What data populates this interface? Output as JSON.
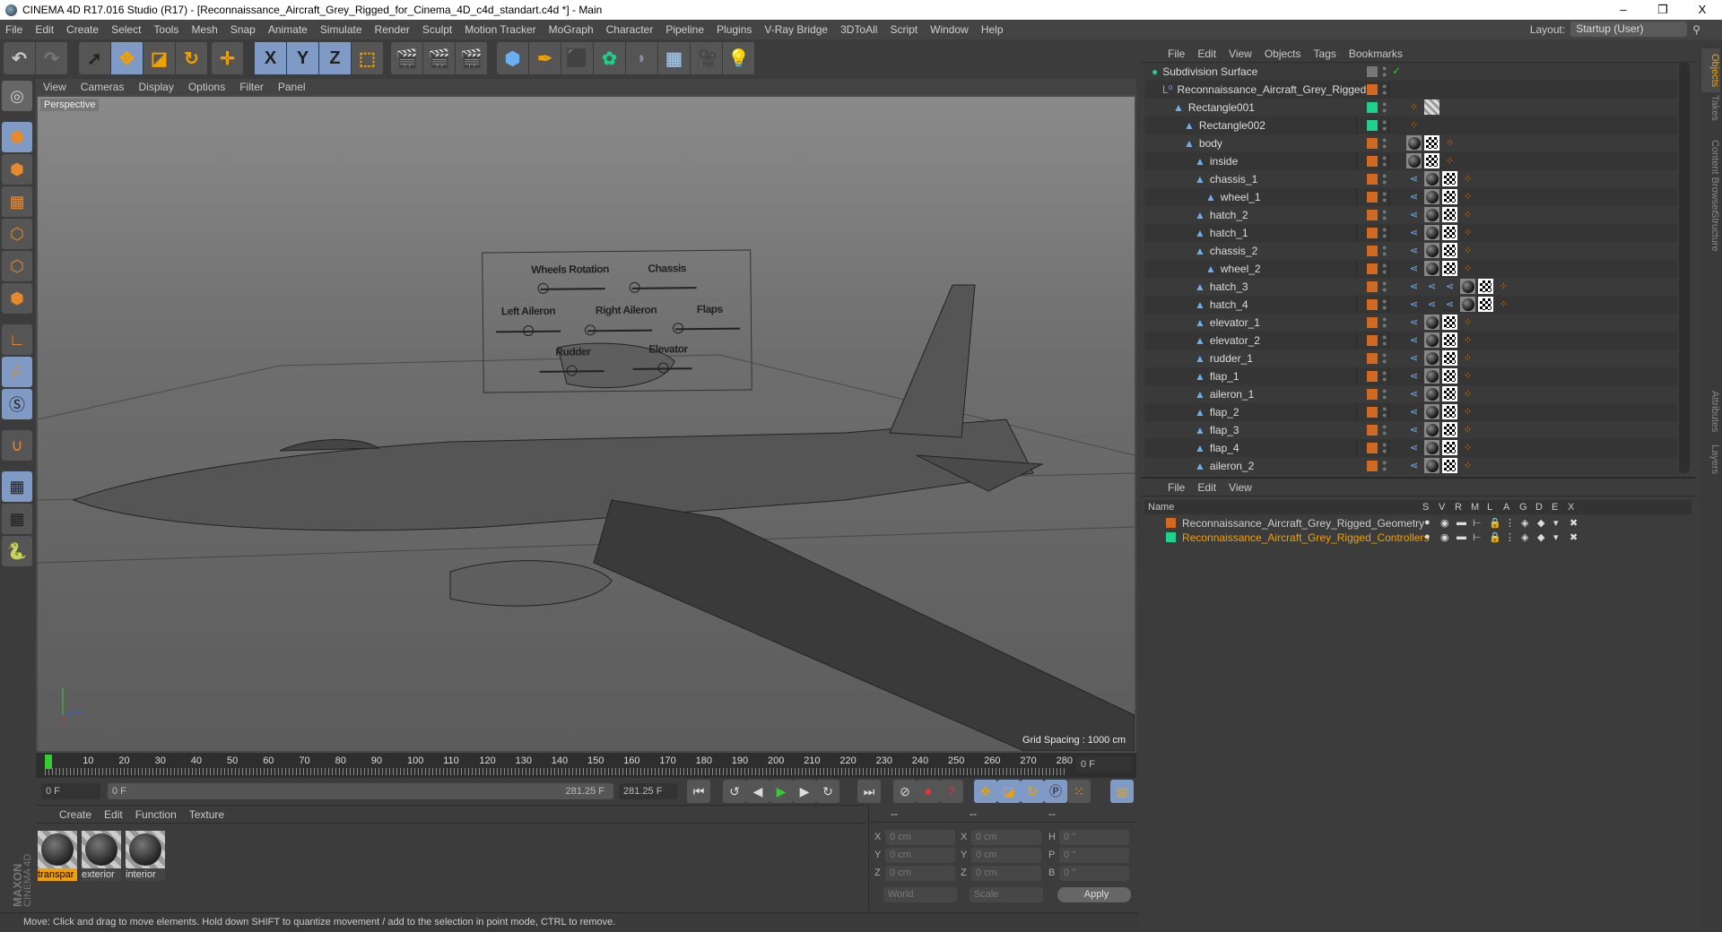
{
  "window": {
    "title": "CINEMA 4D R17.016 Studio (R17) - [Reconnaissance_Aircraft_Grey_Rigged_for_Cinema_4D_c4d_standart.c4d *] - Main",
    "minimize": "–",
    "restore": "❐",
    "close": "X"
  },
  "menu": [
    "File",
    "Edit",
    "Create",
    "Select",
    "Tools",
    "Mesh",
    "Snap",
    "Animate",
    "Simulate",
    "Render",
    "Sculpt",
    "Motion Tracker",
    "MoGraph",
    "Character",
    "Pipeline",
    "Plugins",
    "V-Ray Bridge",
    "3DToAll",
    "Script",
    "Window",
    "Help"
  ],
  "layout": {
    "label": "Layout:",
    "value": "Startup (User)"
  },
  "toolbar": {
    "axis_x": "X",
    "axis_y": "Y",
    "axis_z": "Z"
  },
  "viewport": {
    "menu": [
      "View",
      "Cameras",
      "Display",
      "Options",
      "Filter",
      "Panel"
    ],
    "camera": "Perspective",
    "grid_spacing": "Grid Spacing : 1000 cm",
    "hud": {
      "wheels_rotation": "Wheels Rotation",
      "chassis": "Chassis",
      "left_aileron": "Left Aileron",
      "right_aileron": "Right Aileron",
      "flaps": "Flaps",
      "rudder": "Rudder",
      "elevator": "Elevator"
    }
  },
  "timeline": {
    "ticks": [
      "0",
      "10",
      "20",
      "30",
      "40",
      "50",
      "60",
      "70",
      "80",
      "90",
      "100",
      "110",
      "120",
      "130",
      "140",
      "150",
      "160",
      "170",
      "180",
      "190",
      "200",
      "210",
      "220",
      "230",
      "240",
      "250",
      "260",
      "270",
      "280"
    ],
    "current_frame": "0 F",
    "start": "0 F",
    "range_start": "0 F",
    "range_end": "281.25 F",
    "end": "281.25 F"
  },
  "materials": {
    "menu": [
      "Create",
      "Edit",
      "Function",
      "Texture"
    ],
    "items": [
      {
        "name": "transpar",
        "selected": true
      },
      {
        "name": "exterior"
      },
      {
        "name": "interior"
      }
    ]
  },
  "coords": {
    "headers": [
      "--",
      "--",
      "--"
    ],
    "x": "X",
    "y": "Y",
    "z": "Z",
    "h": "H",
    "p": "P",
    "b": "B",
    "pos": "0 cm",
    "rot": "0 °",
    "world": "World",
    "scale": "Scale",
    "apply": "Apply"
  },
  "status": "Move: Click and drag to move elements. Hold down SHIFT to quantize movement / add to the selection in point mode, CTRL to remove.",
  "objects": {
    "menu": [
      "File",
      "Edit",
      "View",
      "Objects",
      "Tags",
      "Bookmarks"
    ],
    "items": [
      {
        "name": "Subdivision Surface",
        "depth": 0,
        "layer": "",
        "tags": []
      },
      {
        "name": "Reconnaissance_Aircraft_Grey_Rigged",
        "depth": 1,
        "layer": "#d2691e",
        "tags": []
      },
      {
        "name": "Rectangle001",
        "depth": 2,
        "layer": "#1fd18a",
        "tags": [
          "phong",
          "stripe"
        ]
      },
      {
        "name": "Rectangle002",
        "depth": 3,
        "layer": "#1fd18a",
        "tags": [
          "phong"
        ]
      },
      {
        "name": "body",
        "depth": 3,
        "layer": "#d2691e",
        "tags": [
          "mat",
          "tex",
          "phong"
        ]
      },
      {
        "name": "inside",
        "depth": 4,
        "layer": "#d2691e",
        "tags": [
          "mat",
          "tex",
          "phong"
        ]
      },
      {
        "name": "chassis_1",
        "depth": 4,
        "layer": "#d2691e",
        "tags": [
          "ik",
          "mat",
          "tex",
          "phong"
        ]
      },
      {
        "name": "wheel_1",
        "depth": 5,
        "layer": "#d2691e",
        "tags": [
          "ik",
          "mat",
          "tex",
          "phong"
        ]
      },
      {
        "name": "hatch_2",
        "depth": 4,
        "layer": "#d2691e",
        "tags": [
          "ik",
          "mat",
          "tex",
          "phong"
        ]
      },
      {
        "name": "hatch_1",
        "depth": 4,
        "layer": "#d2691e",
        "tags": [
          "ik",
          "mat",
          "tex",
          "phong"
        ]
      },
      {
        "name": "chassis_2",
        "depth": 4,
        "layer": "#d2691e",
        "tags": [
          "ik",
          "mat",
          "tex",
          "phong"
        ]
      },
      {
        "name": "wheel_2",
        "depth": 5,
        "layer": "#d2691e",
        "tags": [
          "ik",
          "mat",
          "tex",
          "phong"
        ]
      },
      {
        "name": "hatch_3",
        "depth": 4,
        "layer": "#d2691e",
        "tags": [
          "ik",
          "ik",
          "ik",
          "mat",
          "tex",
          "phong"
        ]
      },
      {
        "name": "hatch_4",
        "depth": 4,
        "layer": "#d2691e",
        "tags": [
          "ik",
          "ik",
          "ik",
          "mat",
          "tex",
          "phong"
        ]
      },
      {
        "name": "elevator_1",
        "depth": 4,
        "layer": "#d2691e",
        "tags": [
          "ik",
          "mat",
          "tex",
          "phong"
        ]
      },
      {
        "name": "elevator_2",
        "depth": 4,
        "layer": "#d2691e",
        "tags": [
          "ik",
          "mat",
          "tex",
          "phong"
        ]
      },
      {
        "name": "rudder_1",
        "depth": 4,
        "layer": "#d2691e",
        "tags": [
          "ik",
          "mat",
          "tex",
          "phong"
        ]
      },
      {
        "name": "flap_1",
        "depth": 4,
        "layer": "#d2691e",
        "tags": [
          "ik",
          "mat",
          "tex",
          "phong"
        ]
      },
      {
        "name": "aileron_1",
        "depth": 4,
        "layer": "#d2691e",
        "tags": [
          "ik",
          "mat",
          "tex",
          "phong"
        ]
      },
      {
        "name": "flap_2",
        "depth": 4,
        "layer": "#d2691e",
        "tags": [
          "ik",
          "mat",
          "tex",
          "phong"
        ]
      },
      {
        "name": "flap_3",
        "depth": 4,
        "layer": "#d2691e",
        "tags": [
          "ik",
          "mat",
          "tex",
          "phong"
        ]
      },
      {
        "name": "flap_4",
        "depth": 4,
        "layer": "#d2691e",
        "tags": [
          "ik",
          "mat",
          "tex",
          "phong"
        ]
      },
      {
        "name": "aileron_2",
        "depth": 4,
        "layer": "#d2691e",
        "tags": [
          "ik",
          "mat",
          "tex",
          "phong"
        ]
      }
    ]
  },
  "layers": {
    "menu": [
      "File",
      "Edit",
      "View"
    ],
    "columns": [
      "Name",
      "S",
      "V",
      "R",
      "M",
      "L",
      "A",
      "G",
      "D",
      "E",
      "X"
    ],
    "items": [
      {
        "name": "Reconnaissance_Aircraft_Grey_Rigged_Geometry",
        "color": "#d2691e",
        "highlight": false
      },
      {
        "name": "Reconnaissance_Aircraft_Grey_Rigged_Controllers",
        "color": "#1fd18a",
        "highlight": true
      }
    ]
  },
  "side_tabs": [
    "Objects",
    "Takes",
    "Content Browser",
    "Structure",
    "Attributes",
    "Layers"
  ],
  "colors": {
    "accent": "#f0a000",
    "selected_tool": "#7f9ac4",
    "orange_layer": "#d2691e",
    "green_layer": "#1fd18a"
  }
}
